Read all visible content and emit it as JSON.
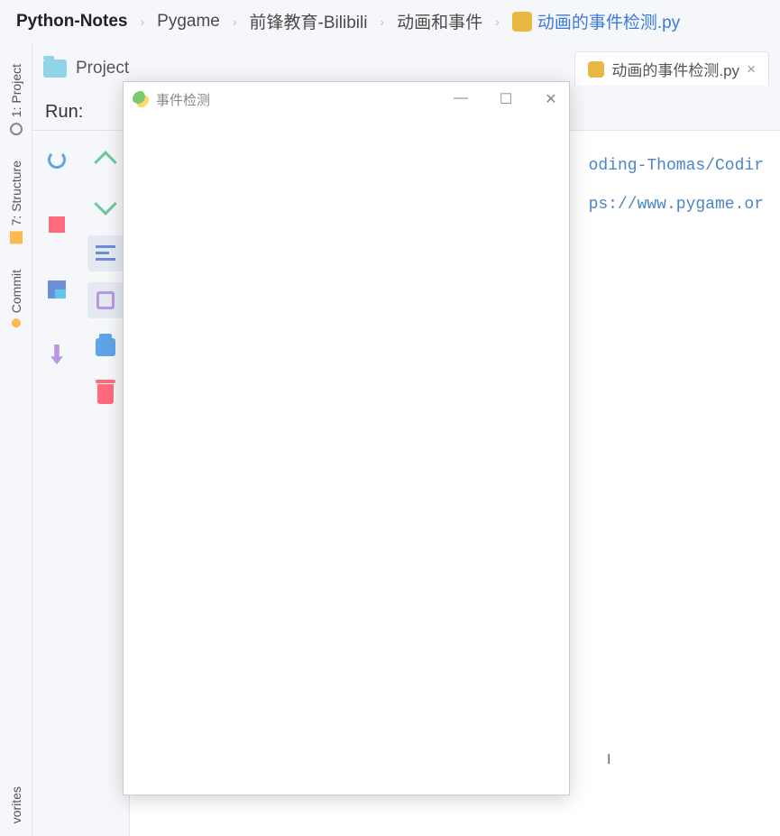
{
  "breadcrumb": {
    "items": [
      "Python-Notes",
      "Pygame",
      "前锋教育-Bilibili",
      "动画和事件"
    ],
    "file": "动画的事件检测.py"
  },
  "project_panel": {
    "title": "Project"
  },
  "left_rail": {
    "project": "1: Project",
    "structure": "7: Structure",
    "commit": "Commit",
    "favorites": "vorites"
  },
  "editor": {
    "tab_label": "动画的事件检测.py",
    "lines": [
      "oding-Thomas/Codir",
      "ps://www.pygame.or"
    ]
  },
  "run_panel": {
    "label": "Run:"
  },
  "pygame_window": {
    "title": "事件检测",
    "minimize": "—",
    "maximize": "☐",
    "close": "✕"
  }
}
